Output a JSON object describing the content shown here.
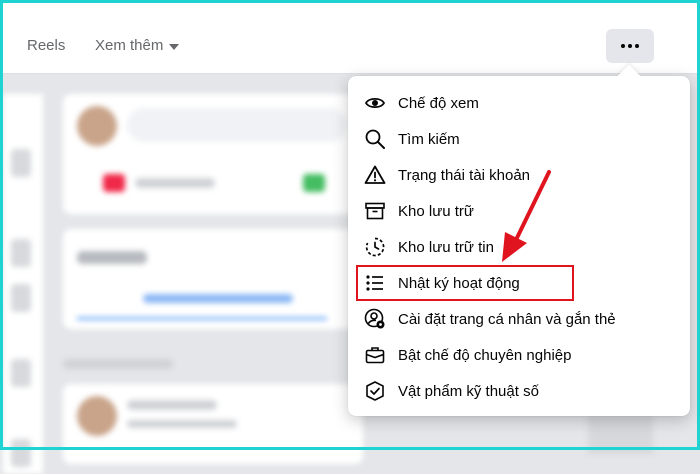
{
  "topbar": {
    "reels_label": "Reels",
    "more_label": "Xem thêm"
  },
  "menu": {
    "items": [
      {
        "label": "Chế độ xem",
        "icon": "eye-icon"
      },
      {
        "label": "Tìm kiếm",
        "icon": "search-icon"
      },
      {
        "label": "Trạng thái tài khoản",
        "icon": "warning-icon"
      },
      {
        "label": "Kho lưu trữ",
        "icon": "archive-icon"
      },
      {
        "label": "Kho lưu trữ tin",
        "icon": "story-archive-icon"
      },
      {
        "label": "Nhật ký hoạt động",
        "icon": "list-icon"
      },
      {
        "label": "Cài đặt trang cá nhân và gắn thẻ",
        "icon": "profile-settings-icon"
      },
      {
        "label": "Bật chế độ chuyên nghiệp",
        "icon": "briefcase-icon"
      },
      {
        "label": "Vật phẩm kỹ thuật số",
        "icon": "shield-check-icon"
      }
    ],
    "highlighted_item": "Nhật ký hoạt động"
  },
  "colors": {
    "highlight_border": "#e0141e",
    "arrow": "#e0141e",
    "frame": "#1fd3d3"
  }
}
